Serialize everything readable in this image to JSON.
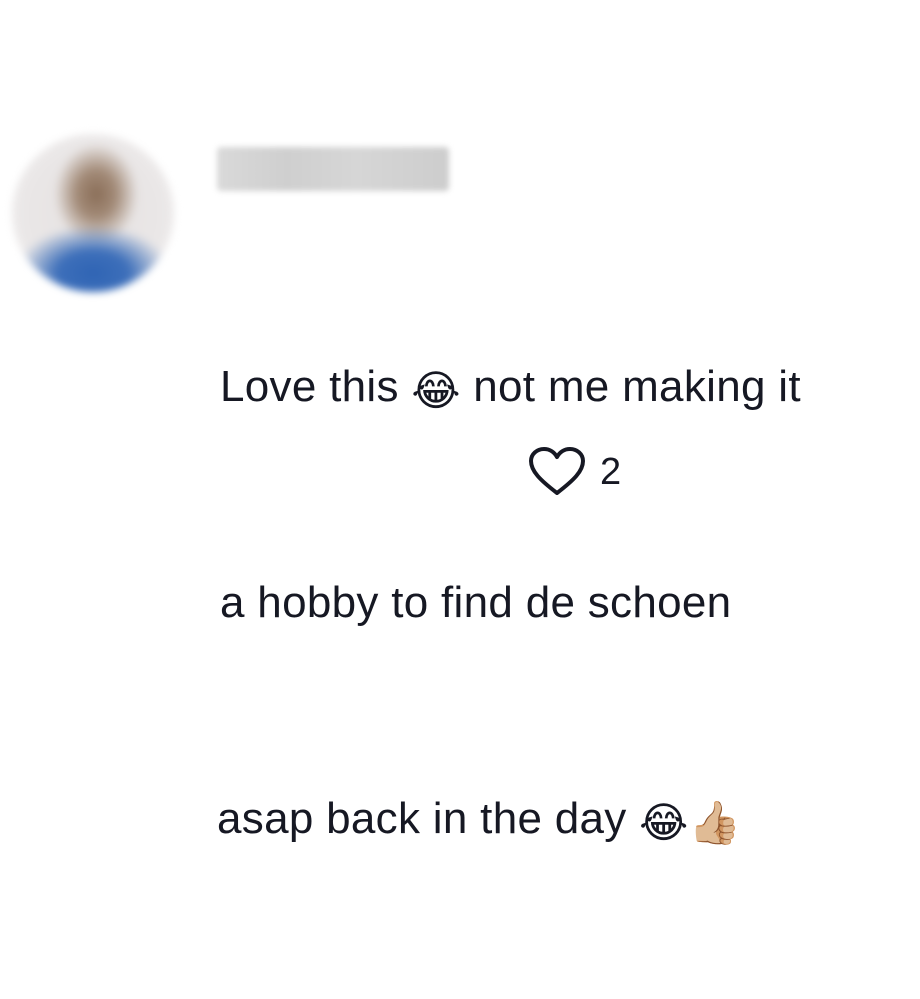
{
  "comment": {
    "username": "",
    "text_lines": [
      {
        "before": "Love this ",
        "emoji": "😂",
        "after": " not me making it"
      },
      {
        "before": "a hobby to find de schoen",
        "emoji": "",
        "after": ""
      },
      {
        "before": "asap back in the day ",
        "emoji": "😂👍🏼",
        "after": ""
      }
    ],
    "likes": "2"
  },
  "icons": {
    "like": "heart-outline-icon"
  },
  "colors": {
    "text": "#161823",
    "icon_stroke": "#161823",
    "background": "#ffffff"
  }
}
